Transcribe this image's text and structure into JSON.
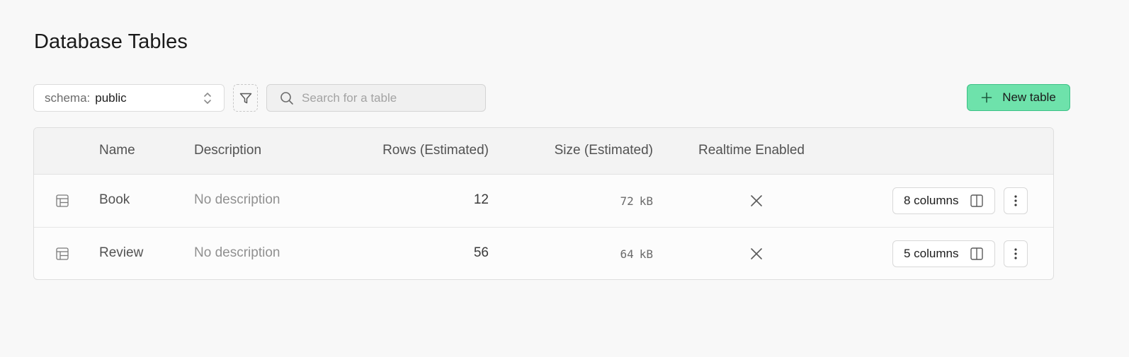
{
  "page": {
    "title": "Database Tables"
  },
  "toolbar": {
    "schema_prefix": "schema:",
    "schema_value": "public",
    "schema_icon": "chevron-up-down-icon",
    "filter_icon": "filter-icon",
    "search_placeholder": "Search for a table",
    "search_value": "",
    "search_icon": "search-icon",
    "new_table_label": "New table",
    "new_table_icon": "plus-icon"
  },
  "table": {
    "headers": {
      "name": "Name",
      "description": "Description",
      "rows": "Rows (Estimated)",
      "size": "Size (Estimated)",
      "realtime": "Realtime Enabled"
    },
    "rows": [
      {
        "icon": "table-icon",
        "name": "Book",
        "description": "No description",
        "rows_estimated": "12",
        "size_value": "72",
        "size_unit": "kB",
        "realtime_icon": "x-icon",
        "columns_label": "8 columns",
        "columns_icon": "columns-icon",
        "more_icon": "more-vertical-icon"
      },
      {
        "icon": "table-icon",
        "name": "Review",
        "description": "No description",
        "rows_estimated": "56",
        "size_value": "64",
        "size_unit": "kB",
        "realtime_icon": "x-icon",
        "columns_label": "5 columns",
        "columns_icon": "columns-icon",
        "more_icon": "more-vertical-icon"
      }
    ]
  },
  "colors": {
    "background": "#f8f8f8",
    "accent_button": "#6ee2ab",
    "accent_border": "#3cc186",
    "header_bg": "#f3f3f3",
    "muted_text": "#909090"
  }
}
